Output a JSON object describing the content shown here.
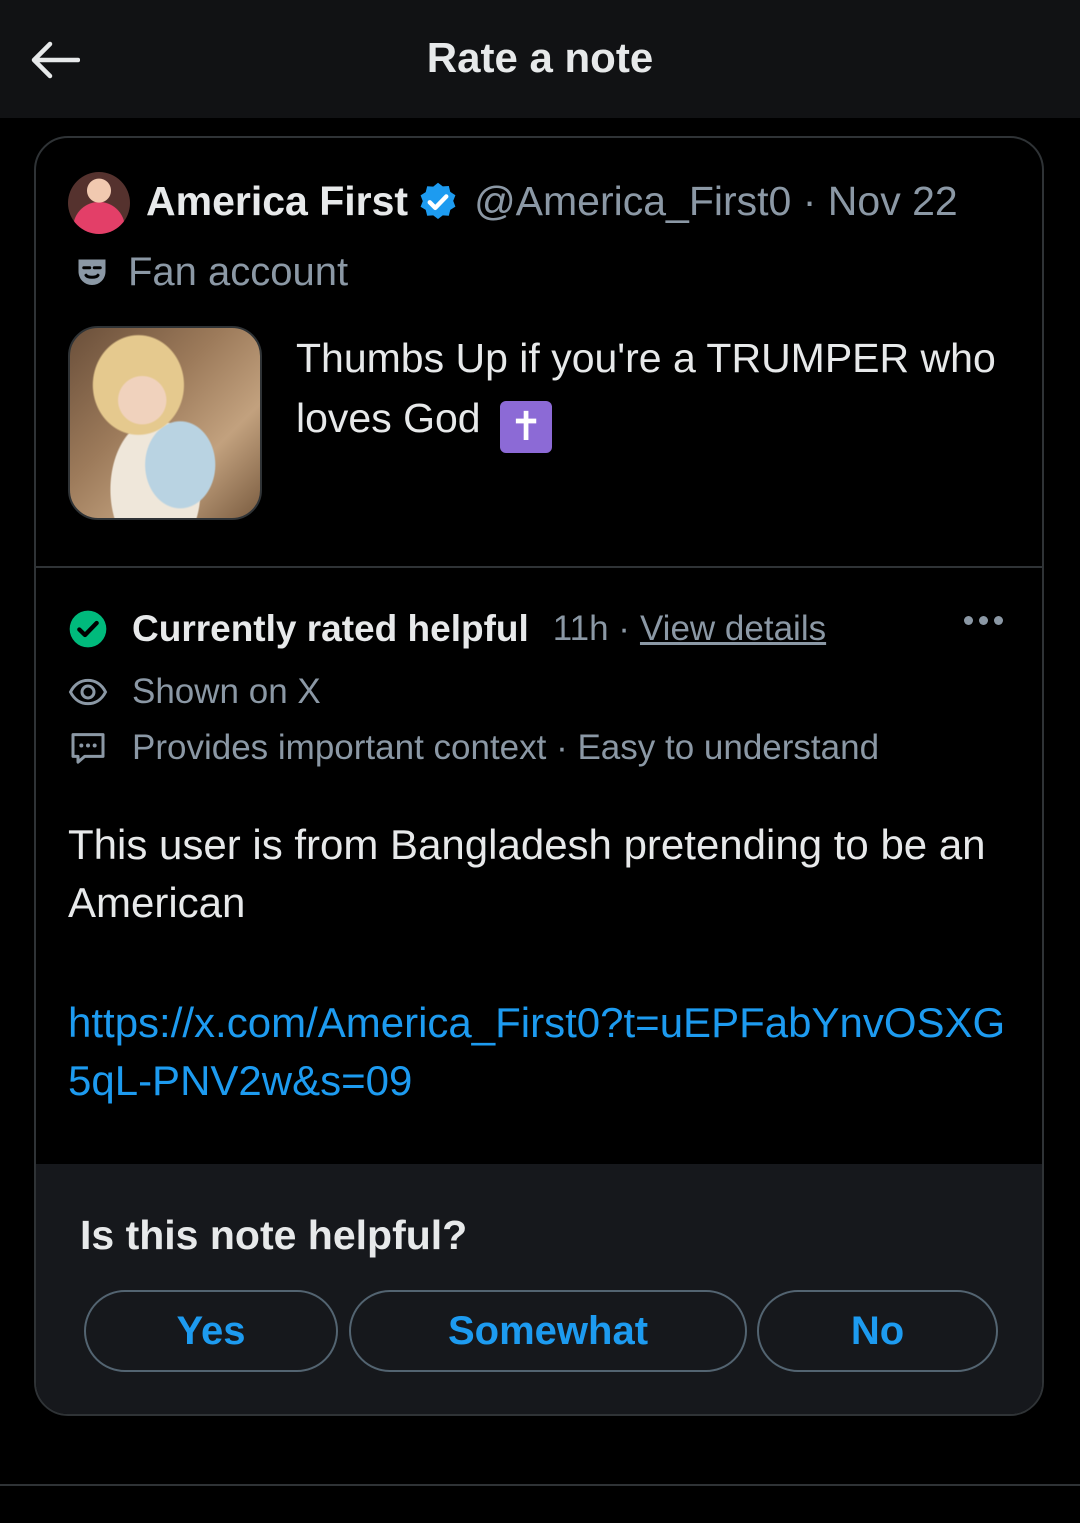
{
  "header": {
    "title": "Rate a note"
  },
  "post": {
    "author_name": "America First",
    "handle_date": "@America_First0 · Nov 22",
    "label": "Fan account",
    "text": "Thumbs Up if you're a TRUMPER who loves God",
    "emoji": "✝"
  },
  "note": {
    "status": "Currently rated helpful",
    "time": "11h ·",
    "view_details": "View details",
    "shown_on": "Shown on X",
    "tags": "Provides important context · Easy to understand",
    "body": "This user is from Bangladesh pretending to be an American",
    "link": "https://x.com/America_First0?t=uEPFabYnvOSXG5qL-PNV2w&s=09"
  },
  "rating": {
    "question": "Is this note helpful?",
    "yes": "Yes",
    "somewhat": "Somewhat",
    "no": "No"
  },
  "colors": {
    "accent": "#1d9bf0",
    "helpful_green": "#00ba7c",
    "muted_text": "#8b98a5",
    "background": "#000000"
  }
}
